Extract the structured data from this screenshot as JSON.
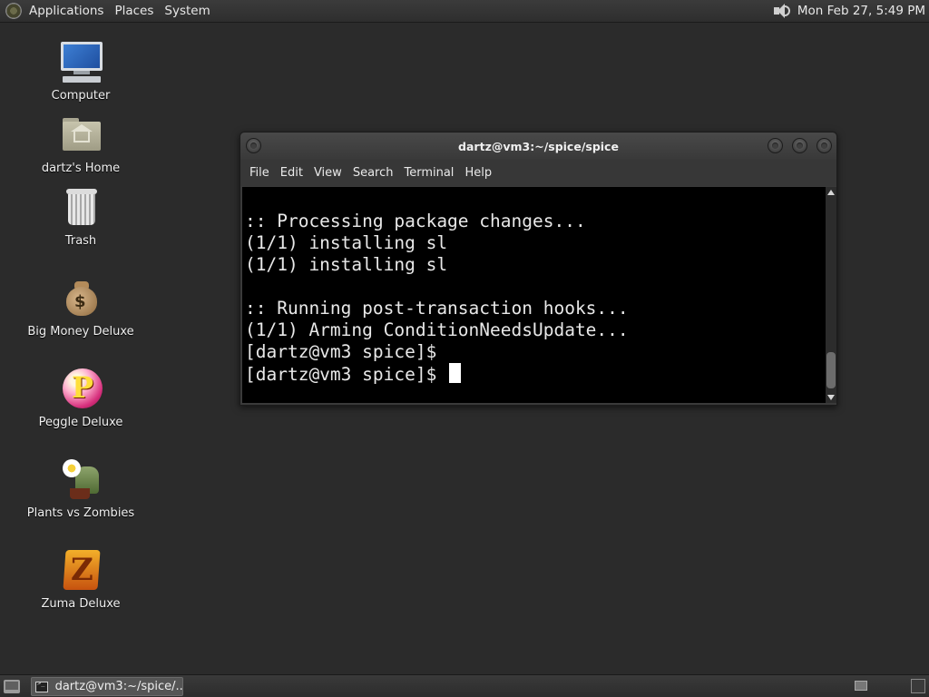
{
  "top_panel": {
    "menus": [
      "Applications",
      "Places",
      "System"
    ],
    "clock": "Mon Feb 27,  5:49 PM"
  },
  "desktop_icons": [
    {
      "label": "Computer",
      "icon": "computer-icon"
    },
    {
      "label": "dartz's Home",
      "icon": "home-folder-icon"
    },
    {
      "label": "Trash",
      "icon": "trash-icon"
    },
    {
      "label": "Big Money Deluxe",
      "icon": "money-bag-icon"
    },
    {
      "label": "Peggle Deluxe",
      "icon": "peggle-icon"
    },
    {
      "label": "Plants vs Zombies",
      "icon": "plants-vs-zombies-icon"
    },
    {
      "label": "Zuma Deluxe",
      "icon": "zuma-icon"
    }
  ],
  "terminal": {
    "title": "dartz@vm3:~/spice/spice",
    "menu": [
      "File",
      "Edit",
      "View",
      "Search",
      "Terminal",
      "Help"
    ],
    "lines": [
      ":: Processing package changes...",
      "(1/1) installing sl",
      "(1/1) installing sl",
      "",
      ":: Running post-transaction hooks...",
      "(1/1) Arming ConditionNeedsUpdate...",
      "[dartz@vm3 spice]$",
      "[dartz@vm3 spice]$ "
    ]
  },
  "taskbar": {
    "window_label": "dartz@vm3:~/spice/..."
  }
}
